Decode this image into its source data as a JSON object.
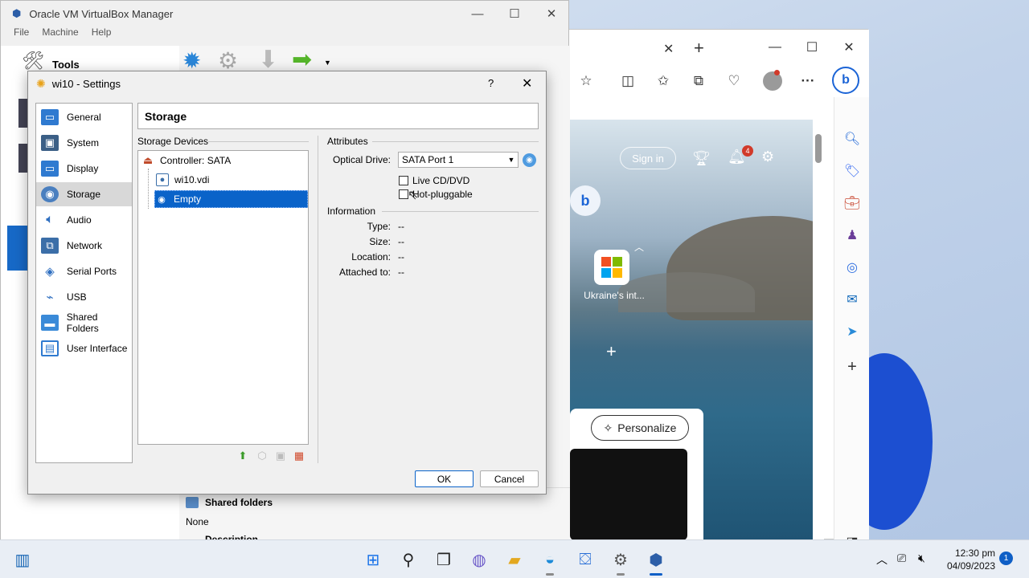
{
  "vbox_manager": {
    "title": "Oracle VM VirtualBox Manager",
    "menu": [
      "File",
      "Machine",
      "Help"
    ],
    "tools_label": "Tools",
    "details": {
      "shared_folders_heading": "Shared folders",
      "shared_folders_value": "None",
      "description_heading": "Description"
    }
  },
  "settings": {
    "title": "wi10 - Settings",
    "help_button": "?",
    "nav": [
      {
        "label": "General",
        "icon": "general-icon"
      },
      {
        "label": "System",
        "icon": "system-icon"
      },
      {
        "label": "Display",
        "icon": "display-icon"
      },
      {
        "label": "Storage",
        "icon": "storage-icon",
        "selected": true
      },
      {
        "label": "Audio",
        "icon": "audio-icon"
      },
      {
        "label": "Network",
        "icon": "network-icon"
      },
      {
        "label": "Serial Ports",
        "icon": "serial-ports-icon"
      },
      {
        "label": "USB",
        "icon": "usb-icon"
      },
      {
        "label": "Shared Folders",
        "icon": "shared-folders-icon"
      },
      {
        "label": "User Interface",
        "icon": "user-interface-icon"
      }
    ],
    "page_title": "Storage",
    "storage_devices_label": "Storage Devices",
    "tree": {
      "controller": "Controller: SATA",
      "disk": "wi10.vdi",
      "optical": "Empty"
    },
    "attributes_label": "Attributes",
    "optical_drive_label": "Optical Drive:",
    "optical_drive_value": "SATA Port 1",
    "live_cd_label": "Live CD/DVD",
    "hot_pluggable_label": "Hot-pluggable",
    "information_label": "Information",
    "info": [
      {
        "key": "Type:",
        "value": "--"
      },
      {
        "key": "Size:",
        "value": "--"
      },
      {
        "key": "Location:",
        "value": "--"
      },
      {
        "key": "Attached to:",
        "value": "--"
      }
    ],
    "ok_label": "OK",
    "cancel_label": "Cancel"
  },
  "edge": {
    "sign_in": "Sign in",
    "notification_count": "4",
    "tile_label": "Ukraine's int...",
    "personalize": "Personalize"
  },
  "taskbar": {
    "time": "12:30 pm",
    "date": "04/09/2023",
    "notification_count": "1"
  }
}
